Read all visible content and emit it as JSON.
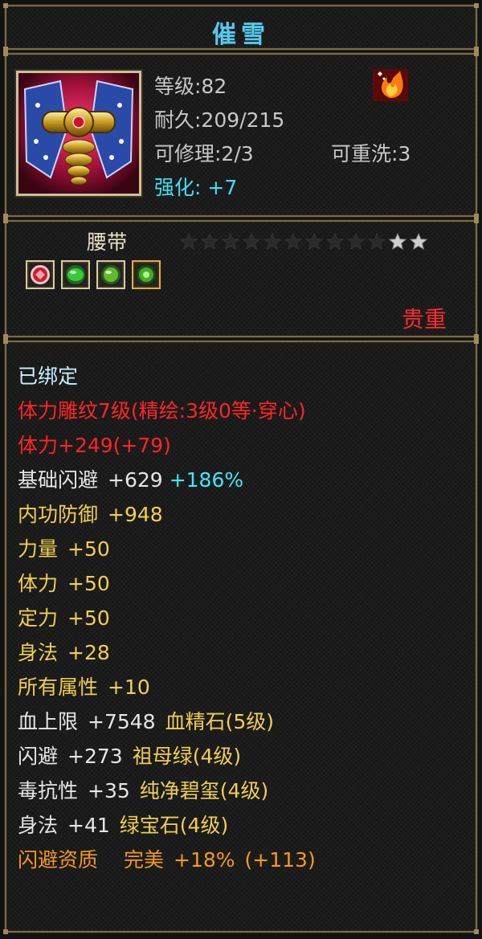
{
  "item": {
    "name": "催雪",
    "level_label": "等级:82",
    "durability_label": "耐久:209/215",
    "repairable_label": "可修理:2/3",
    "rewash_label": "可重洗:3",
    "strength_label": "强化: +7",
    "type": "腰带",
    "rarity": "贵重",
    "stars_total": 12,
    "stars_lit": 2,
    "gem_slots": [
      "red-gem",
      "green-gem",
      "green-gem",
      "green-gem"
    ]
  },
  "attributes": {
    "bound": "已绑定",
    "engrave": "体力雕纹7级(精绘:3级0等·穿心)",
    "stamina_main": "体力+249(+79)",
    "dodge_base_label": "基础闪避",
    "dodge_base_value": "+629",
    "dodge_base_pct": "+186%",
    "inner_def_label": "内功防御",
    "inner_def_value": "+948",
    "str_label": "力量",
    "str_value": "+50",
    "sta_label": "体力",
    "sta_value": "+50",
    "foc_label": "定力",
    "foc_value": "+50",
    "agi_label": "身法",
    "agi_value": "+28",
    "all_label": "所有属性",
    "all_value": "+10",
    "gem1_stat": "血上限",
    "gem1_value": "+7548",
    "gem1_name": "血精石(5级)",
    "gem2_stat": "闪避",
    "gem2_value": "+273",
    "gem2_name": "祖母绿(4级)",
    "gem3_stat": "毒抗性",
    "gem3_value": "+35",
    "gem3_name": "纯净碧玺(4级)",
    "gem4_stat": "身法",
    "gem4_value": "+41",
    "gem4_name": "绿宝石(4级)",
    "quality_label": "闪避资质",
    "quality_grade": "完美",
    "quality_value": "+18%",
    "quality_bonus": "(+113)"
  },
  "colors": {
    "title": "#5bc8e8",
    "rarity": "#ff2b2b",
    "yellow": "#f0cf50",
    "red": "#ff2424",
    "cyan": "#40e8f8",
    "orange": "#f29a1c"
  }
}
